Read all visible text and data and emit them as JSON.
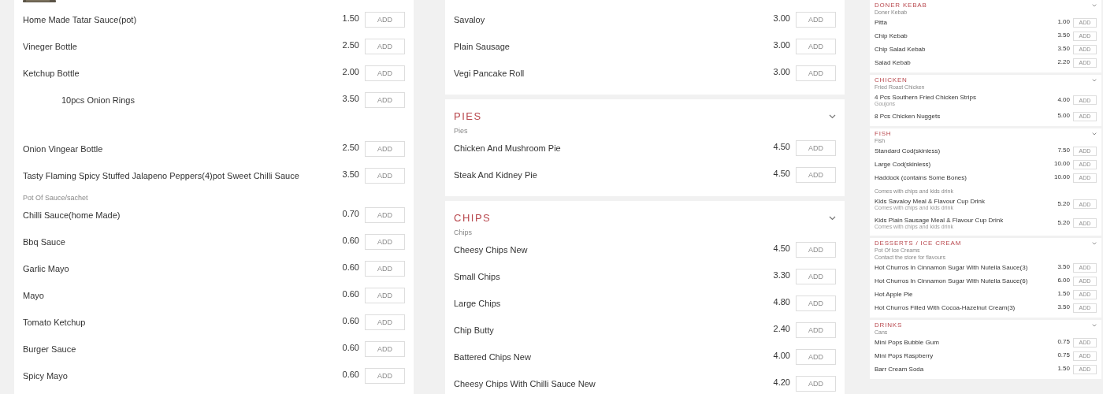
{
  "columns": [
    {
      "cards": [
        {
          "picture": true,
          "groups": [
            {
              "items": [
                {
                  "name": "Home Made Tatar Sauce(pot)",
                  "price": "1.50",
                  "button": "ADD"
                },
                {
                  "name": "Vineger Bottle",
                  "price": "2.50",
                  "button": "ADD"
                },
                {
                  "name": "Ketchup Bottle",
                  "price": "2.00",
                  "button": "ADD"
                },
                {
                  "name": "10pcs Onion Rings",
                  "price": "3.50",
                  "button": "ADD",
                  "kind": "indented"
                },
                {
                  "name": "Onion Vingear Bottle",
                  "price": "2.50",
                  "button": "ADD"
                },
                {
                  "name": "Tasty Flaming Spicy Stuffed Jalapeno Peppers(4)pot Sweet Chilli Sauce",
                  "price": "3.50",
                  "button": "ADD"
                }
              ]
            },
            {
              "subtitles": [
                "Pot Of Sauce/sachet"
              ],
              "items": [
                {
                  "name": "Chilli Sauce(home Made)",
                  "price": "0.70",
                  "button": "ADD"
                },
                {
                  "name": "Bbq Sauce",
                  "price": "0.60",
                  "button": "ADD"
                },
                {
                  "name": "Garlic Mayo",
                  "price": "0.60",
                  "button": "ADD"
                },
                {
                  "name": "Mayo",
                  "price": "0.60",
                  "button": "ADD"
                },
                {
                  "name": "Tomato Ketchup",
                  "price": "0.60",
                  "button": "ADD"
                },
                {
                  "name": "Burger Sauce",
                  "price": "0.60",
                  "button": "ADD"
                },
                {
                  "name": "Spicy Mayo",
                  "price": "0.60",
                  "button": "ADD"
                }
              ]
            }
          ]
        }
      ]
    },
    {
      "cards": [
        {
          "groups": [
            {
              "items": [
                {
                  "name": "Savaloy",
                  "price": "3.00",
                  "button": "ADD"
                },
                {
                  "name": "Plain Sausage",
                  "price": "3.00",
                  "button": "ADD"
                },
                {
                  "name": "Vegi Pancake Roll",
                  "price": "3.00",
                  "button": "ADD"
                }
              ]
            }
          ]
        },
        {
          "title": "PIES",
          "groups": [
            {
              "subtitles": [
                "Pies"
              ],
              "items": [
                {
                  "name": "Chicken And Mushroom Pie",
                  "price": "4.50",
                  "button": "ADD"
                },
                {
                  "name": "Steak And Kidney Pie",
                  "price": "4.50",
                  "button": "ADD"
                }
              ]
            }
          ]
        },
        {
          "title": "CHIPS",
          "groups": [
            {
              "subtitles": [
                "Chips"
              ],
              "items": [
                {
                  "name": "Cheesy Chips New",
                  "price": "4.50",
                  "button": "ADD"
                },
                {
                  "name": "Small Chips",
                  "price": "3.30",
                  "button": "ADD"
                },
                {
                  "name": "Large Chips",
                  "price": "4.80",
                  "button": "ADD"
                },
                {
                  "name": "Chip Butty",
                  "price": "2.40",
                  "button": "ADD"
                },
                {
                  "name": "Battered Chips New",
                  "price": "4.00",
                  "button": "ADD"
                },
                {
                  "name": "Cheesy Chips With Chilli Sauce New",
                  "price": "4.20",
                  "button": "ADD"
                }
              ]
            }
          ]
        }
      ]
    },
    {
      "cards": [
        {
          "title": "DONER KEBAB",
          "groups": [
            {
              "subtitles": [
                "Doner Kebab"
              ],
              "items": [
                {
                  "name": "Pitta",
                  "price": "1.00",
                  "button": "ADD"
                },
                {
                  "name": "Chip Kebab",
                  "price": "3.50",
                  "button": "ADD"
                },
                {
                  "name": "Chip Salad Kebab",
                  "price": "3.50",
                  "button": "ADD"
                },
                {
                  "name": "Salad Kebab",
                  "price": "2.20",
                  "button": "ADD"
                }
              ]
            }
          ]
        },
        {
          "title": "CHICKEN",
          "groups": [
            {
              "subtitles": [
                "Fried Roast Chicken"
              ],
              "items": [
                {
                  "name": "4 Pcs Southern Fried Chicken Strips",
                  "description": "Goujons",
                  "price": "4.00",
                  "button": "ADD"
                },
                {
                  "name": "8 Pcs Chicken Nuggets",
                  "price": "5.00",
                  "button": "ADD"
                }
              ]
            }
          ]
        },
        {
          "title": "FISH",
          "groups": [
            {
              "subtitles": [
                "Fish"
              ],
              "items": [
                {
                  "name": "Standard Cod(skinless)",
                  "price": "7.50",
                  "button": "ADD"
                },
                {
                  "name": "Large Cod(skinless)",
                  "price": "10.00",
                  "button": "ADD"
                },
                {
                  "name": "Haddock (contains Some Bones)",
                  "price": "10.00",
                  "button": "ADD"
                }
              ]
            }
          ]
        },
        {
          "joined": true,
          "groups": [
            {
              "subtitles": [
                "Comes with chips and kids drink"
              ],
              "items": [
                {
                  "name": "Kids Savaloy Meal & Flavour Cup Drink",
                  "description": "Comes with chips and kids drink",
                  "price": "5.20",
                  "button": "ADD"
                },
                {
                  "name": "Kids Plain Sausage Meal & Flavour Cup Drink",
                  "description": "Comes with chips and kids drink",
                  "price": "5.20",
                  "button": "ADD"
                }
              ]
            }
          ]
        },
        {
          "title": "DESSERTS / ICE CREAM",
          "groups": [
            {
              "subtitles": [
                "Pot Of Ice Creams",
                "Contact the store for flavours"
              ],
              "items": [
                {
                  "name": "Hot Churros In Cinnamon Sugar With Nutella Sauce(3)",
                  "price": "3.50",
                  "button": "ADD"
                },
                {
                  "name": "Hot Churros In Cinnamon Sugar With Nutella Sauce(6)",
                  "price": "6.00",
                  "button": "ADD"
                },
                {
                  "name": "Hot Apple Pie",
                  "price": "1.50",
                  "button": "ADD"
                },
                {
                  "name": "Hot Churros Filled With Cocoa-Hazelnut Cream(3)",
                  "price": "3.50",
                  "button": "ADD"
                }
              ]
            }
          ]
        },
        {
          "title": "DRINKS",
          "groups": [
            {
              "subtitles": [
                "Cans"
              ],
              "items": [
                {
                  "name": "Mini Pops Bubble Gum",
                  "price": "0.75",
                  "button": "ADD"
                },
                {
                  "name": "Mini Pops Raspberry",
                  "price": "0.75",
                  "button": "ADD"
                },
                {
                  "name": "Barr Cream Soda",
                  "price": "1.50",
                  "button": "ADD"
                }
              ]
            }
          ]
        }
      ]
    }
  ]
}
